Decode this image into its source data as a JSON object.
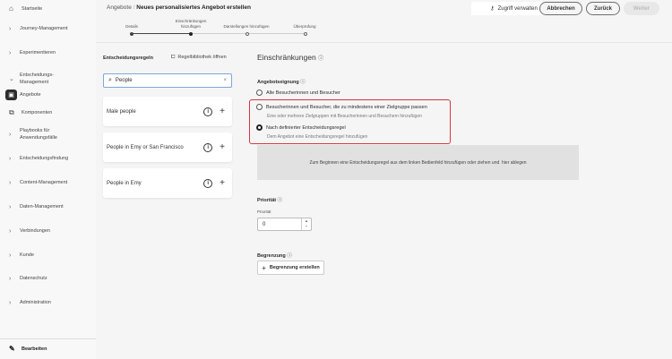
{
  "sidebar": {
    "items": [
      {
        "label": "Startseite"
      },
      {
        "label": "Journey-Management"
      },
      {
        "label": "Experimentieren"
      },
      {
        "label": "Entscheidungs-Management"
      },
      {
        "label": "Angebote"
      },
      {
        "label": "Komponenten"
      },
      {
        "label": "Playbooks für Anwendungsfälle"
      },
      {
        "label": "Entscheidungsfindung"
      },
      {
        "label": "Content-Management"
      },
      {
        "label": "Daten-Management"
      },
      {
        "label": "Verbindungen"
      },
      {
        "label": "Kunde"
      },
      {
        "label": "Datenschutz"
      },
      {
        "label": "Administration"
      }
    ],
    "edit": "Bearbeiten"
  },
  "header": {
    "breadcrumb_parent": "Angebote",
    "title": "Neues personalisiertes Angebot erstellen",
    "access": "Zugriff verwalten",
    "cancel": "Abbrechen",
    "back": "Zurück",
    "next": "Weiter"
  },
  "steps": [
    {
      "label": "Details"
    },
    {
      "label": "Einschränkungen hinzufügen"
    },
    {
      "label": "Darstellungen hinzufügen"
    },
    {
      "label": "Überprüfung"
    }
  ],
  "rules": {
    "title": "Entscheidungsregeln",
    "library": "Regelbibliothek öffnen",
    "search": "People",
    "items": [
      {
        "name": "Male people"
      },
      {
        "name": "People in Emy or San Francisco"
      },
      {
        "name": "People in Emy"
      }
    ]
  },
  "constraints": {
    "title": "Einschränkungen",
    "eligibility": "Angebotseignung",
    "opt1": "Alle Besucherinnen und Besucher",
    "opt2": "Besucherinnen und Besucher, die zu mindestens einer Zielgruppe passen",
    "opt2_desc": "Eine oder mehrere Zielgruppen mit Besucherinnen und Besuchern hinzufügen",
    "opt3": "Nach definierter Entscheidungsregel",
    "opt3_desc": "Dem Angebot eine Entscheidungsregel hinzufügen",
    "drop": "Zum Beginnen eine Entscheidungsregel aus dem linken Bedienfeld hinzufügen oder ziehen und  hier ablegen",
    "priority_title": "Priorität",
    "priority_label": "Priorität",
    "priority_value": "0",
    "cap_title": "Begrenzung",
    "cap_button": "Begrenzung erstellen"
  },
  "colors": {
    "highlight": "#d7373f"
  }
}
